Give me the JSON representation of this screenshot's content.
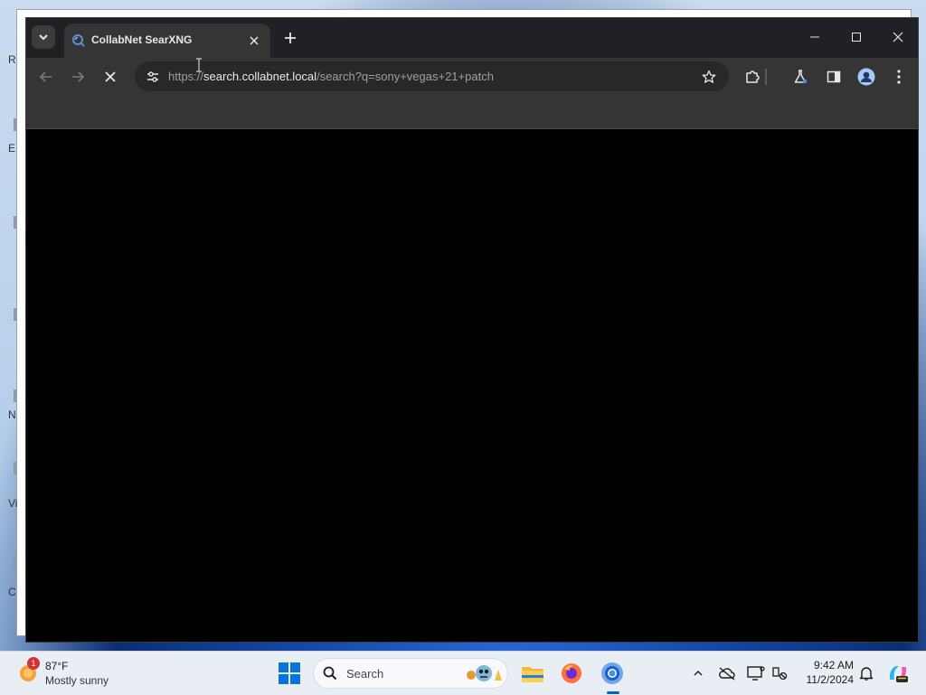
{
  "browser": {
    "tab_title": "CollabNet SearXNG",
    "url_scheme": "https://",
    "url_host": "search.collabnet.local",
    "url_path": "/search?q=sony+vegas+21+patch",
    "loading": true
  },
  "desktop": {
    "edge_fragments": [
      "R",
      "E",
      "N",
      "Vi",
      "C"
    ]
  },
  "taskbar": {
    "weather_temp": "87°F",
    "weather_desc": "Mostly sunny",
    "weather_badge": "1",
    "search_label": "Search",
    "time": "9:42 AM",
    "date": "11/2/2024"
  },
  "colors": {
    "tab_strip": "#202124",
    "toolbar": "#353535",
    "content": "#000000",
    "taskbar": "#e9eef5",
    "accent": "#0067c0"
  },
  "icons": {
    "tab_search": "chevron-down-icon",
    "favicon": "searxng-icon",
    "tab_close": "close-icon",
    "new_tab": "plus-icon",
    "back": "arrow-left-icon",
    "forward": "arrow-right-icon",
    "stop": "stop-icon",
    "site_info": "tune-icon",
    "bookmark": "star-icon",
    "extensions": "puzzle-icon",
    "labs": "flask-icon",
    "side_panel": "side-panel-icon",
    "profile": "profile-icon",
    "menu": "kebab-menu-icon"
  }
}
